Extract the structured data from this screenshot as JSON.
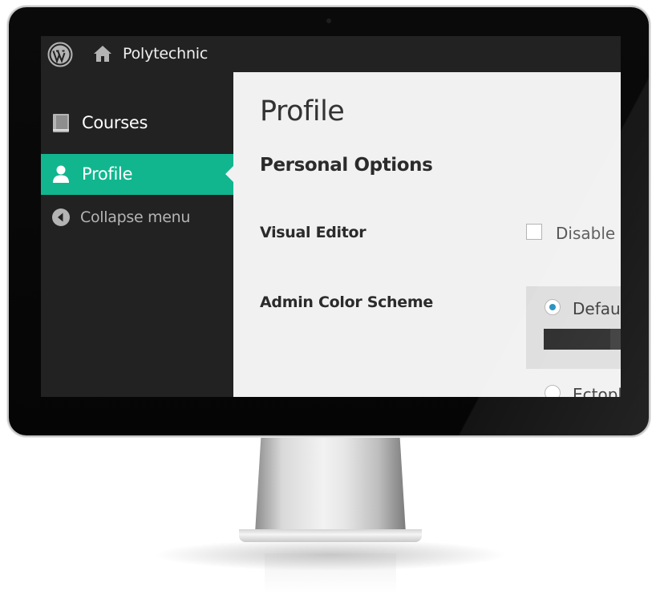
{
  "admin_bar": {
    "site_name": "Polytechnic"
  },
  "sidebar": {
    "items": [
      {
        "label": "Courses",
        "icon": "book-icon"
      },
      {
        "label": "Profile",
        "icon": "user-icon",
        "active": true
      },
      {
        "label": "Collapse menu",
        "icon": "collapse-arrow-icon"
      }
    ]
  },
  "main": {
    "page_title": "Profile",
    "section_title": "Personal Options",
    "visual_editor": {
      "label": "Visual Editor",
      "checkbox_text": "Disable t"
    },
    "color_scheme": {
      "label": "Admin Color Scheme",
      "options": [
        {
          "label": "Defau",
          "selected": true
        },
        {
          "label": "Ectopl",
          "selected": false
        }
      ]
    }
  },
  "colors": {
    "accent": "#11b68f",
    "sidebar_bg": "#222222",
    "content_bg": "#f1f1f1",
    "radio_selected": "#1e8cbe"
  }
}
